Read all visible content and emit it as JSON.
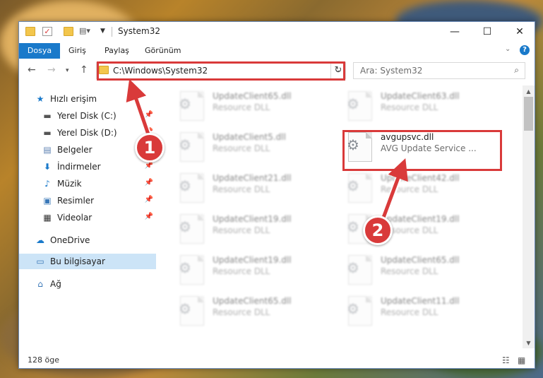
{
  "window": {
    "title": "System32",
    "ribbon_tabs": [
      "Dosya",
      "Giriş",
      "Paylaş",
      "Görünüm"
    ],
    "address": "C:\\Windows\\System32",
    "search_placeholder": "Ara: System32",
    "status": "128 öge"
  },
  "nav": {
    "items": [
      {
        "label": "Hızlı erişim",
        "icon": "star-icon"
      },
      {
        "label": "Yerel Disk (C:)",
        "icon": "drive-icon"
      },
      {
        "label": "Yerel Disk (D:)",
        "icon": "drive-icon"
      },
      {
        "label": "Belgeler",
        "icon": "documents-icon"
      },
      {
        "label": "İndirmeler",
        "icon": "download-icon"
      },
      {
        "label": "Müzik",
        "icon": "music-icon"
      },
      {
        "label": "Resimler",
        "icon": "pictures-icon"
      },
      {
        "label": "Videolar",
        "icon": "video-icon"
      },
      {
        "label": "OneDrive",
        "icon": "cloud-icon"
      },
      {
        "label": "Bu bilgisayar",
        "icon": "computer-icon"
      },
      {
        "label": "Ağ",
        "icon": "network-icon"
      }
    ]
  },
  "files": [
    {
      "name": "UpdateClient65.dll",
      "desc": "Resource DLL"
    },
    {
      "name": "UpdateClient63.dll",
      "desc": "Resource DLL"
    },
    {
      "name": "UpdateClient5.dll",
      "desc": "Resource DLL"
    },
    {
      "name": "avgupsvc.dll",
      "desc": "AVG Update Service ..."
    },
    {
      "name": "UpdateClient21.dll",
      "desc": "Resource DLL"
    },
    {
      "name": "UpdateClient42.dll",
      "desc": "Resource DLL"
    },
    {
      "name": "UpdateClient19.dll",
      "desc": "Resource DLL"
    },
    {
      "name": "UpdateClient19.dll",
      "desc": "Resource DLL"
    },
    {
      "name": "UpdateClient19.dll",
      "desc": "Resource DLL"
    },
    {
      "name": "UpdateClient65.dll",
      "desc": "Resource DLL"
    },
    {
      "name": "UpdateClient65.dll",
      "desc": "Resource DLL"
    },
    {
      "name": "UpdateClient11.dll",
      "desc": "Resource DLL"
    }
  ],
  "callouts": [
    "1",
    "2"
  ],
  "colors": {
    "accent": "#1979ca",
    "highlight": "#d93a3a",
    "selected": "#cce4f7"
  }
}
